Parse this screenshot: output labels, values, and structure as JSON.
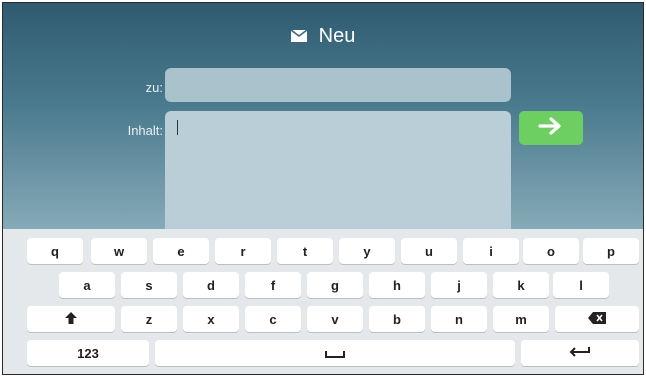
{
  "header": {
    "title": "Neu",
    "icon": "envelope-icon"
  },
  "form": {
    "to_label": "zu:",
    "to_value": "",
    "content_label": "Inhalt:",
    "content_value": ""
  },
  "send_button": {
    "icon": "send-arrow-icon",
    "color": "#6dcf62"
  },
  "keyboard": {
    "row1": [
      "q",
      "w",
      "e",
      "r",
      "t",
      "y",
      "u",
      "i",
      "o",
      "p"
    ],
    "row2": [
      "a",
      "s",
      "d",
      "f",
      "g",
      "h",
      "j",
      "k",
      "l"
    ],
    "row3": [
      "z",
      "x",
      "c",
      "v",
      "b",
      "n",
      "m"
    ],
    "numbers_key": "123",
    "shift_icon": "shift-icon",
    "backspace_icon": "backspace-icon",
    "space_icon": "space-icon",
    "enter_icon": "enter-icon"
  }
}
